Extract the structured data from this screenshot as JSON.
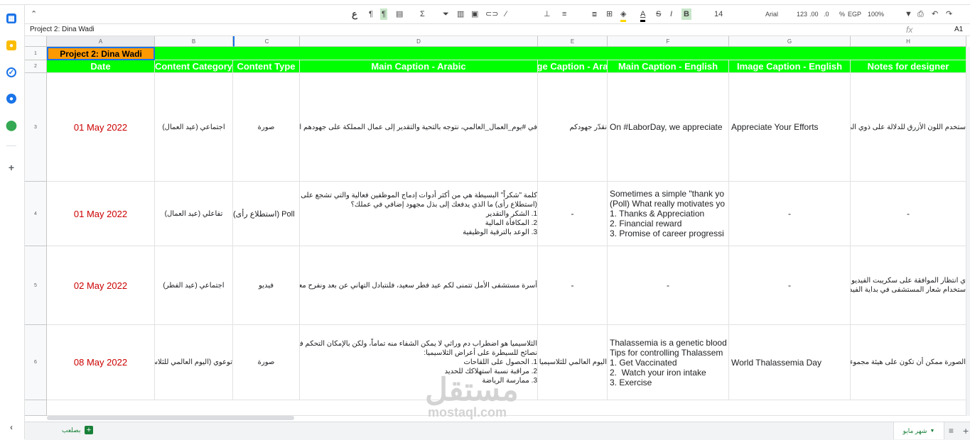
{
  "toolbar": {
    "collapse_icon": "chevron-up-icon",
    "font_size": "14",
    "font_name": "Arial",
    "format_number": "123",
    "format_decimal": ".00",
    "format_decimal_dec": ".0",
    "format_percent": "%",
    "currency": "EGP",
    "zoom": "100%",
    "bold_label": "B",
    "text_color_label": "A",
    "strike_label": "S",
    "arabic_letter": "ع"
  },
  "formula_bar": {
    "name_box": "A1",
    "fx_label": "fx",
    "content": "Project 2: Dina Wadi"
  },
  "columns": [
    "A",
    "B",
    "C",
    "D",
    "E",
    "F",
    "G",
    "H"
  ],
  "rows": [
    "1",
    "2",
    "3",
    "4",
    "5",
    "6"
  ],
  "title_cell": "Project 2: Dina Wadi",
  "headers": [
    "Date",
    "Content Category",
    "Content Type",
    "Main Caption -  Arabic",
    "ge Caption - Ara",
    "Main Caption -  English",
    "Image Caption - English",
    "Notes for designer"
  ],
  "row3": {
    "date": "01 May 2022",
    "category": "اجتماعي (عيد العمال)",
    "type": "صورة",
    "main_ar": "في #يوم_العمال_العالمي، نتوجه بالتحية والتقدير إلى عمال المملكة على جهودهم المخ",
    "img_ar": "نقدّر جهودكم",
    "main_en": "On #LaborDay, we appreciate",
    "img_en": "Appreciate Your Efforts",
    "notes": "ستخدم اللون الأزرق للدلالة على ذوي الي"
  },
  "row4": {
    "date": "01 May 2022",
    "category": "تفاعلي (عيد العمال)",
    "type": "Poll (استطلاع رأى)",
    "main_ar_lines": [
      "كلمة \"شكراً\" البسيطة هي من أكثر أدوات إدماج الموظفين فعالية والتي تشجع على اس",
      "",
      "(استطلاع رأى) ما الذي يدفعك إلى بذل مجهود إضافي في عملك؟",
      "1. الشكر والتقدير",
      "2. المكافأة المالية",
      "3. الوعد بالترقية الوظيفية"
    ],
    "img_ar": "-",
    "main_en_lines": [
      "Sometimes a simple \"thank yo",
      "(Poll) What really motivates yo",
      "1. Thanks & Appreciation",
      "2. Financial reward",
      "3. Promise of career progressi"
    ],
    "img_en": "-",
    "notes": "-"
  },
  "row5": {
    "date": "02 May 2022",
    "category": "اجتماعي (عيد الفطر)",
    "type": "فيديو",
    "main_ar": "أسرة مستشفى الأمل تتمنى لكم عيد فطر سعيد، فلنتبادل التهاني عن بعد ونفرح معاً ببه",
    "img_ar": "-",
    "main_en": "-",
    "img_en": "-",
    "notes_lines": [
      "ي انتظار الموافقة على سكريبت الفيديو",
      "ستخدام شعار المستشفى في بداية الفيديو"
    ]
  },
  "row6": {
    "date": "08 May 2022",
    "category": "توعوي (اليوم العالمي للثلاسيميا",
    "type": "صورة",
    "main_ar_lines": [
      "الثلاسيميا هو اضطراب دم وراثي لا يمكن الشفاء منه تماماً، ولكن بالإمكان التحكم في",
      "",
      "نصائح للسيطرة على أعراض الثلاسيميا:",
      "1. الحصول على اللقاحات",
      "2. مراقبة نسبة استهلاكك للحديد",
      "3. ممارسة الرياضة"
    ],
    "img_ar": "اليوم العالمي للثلاسيميا",
    "main_en_lines": [
      "Thalassemia is a genetic blood",
      "",
      "Tips for controlling Thalassem",
      "1. Get Vaccinated",
      "2.  Watch your iron intake",
      "3. Exercise"
    ],
    "img_en": "World Thalassemia Day",
    "notes": "الصورة ممكن أن تكون على هيئة مجموء"
  },
  "sheet_tabs": {
    "active_tab": "شهر مايو",
    "other_tab": "بصلعب",
    "add_sheet_icon": "plus-icon",
    "all_sheets_icon": "menu-icon"
  },
  "watermark": {
    "arabic": "مستقل",
    "latin": "mostaql.com"
  },
  "colors": {
    "header_green": "#00ff00",
    "title_orange": "#ff9900",
    "date_red": "#cc0000"
  }
}
